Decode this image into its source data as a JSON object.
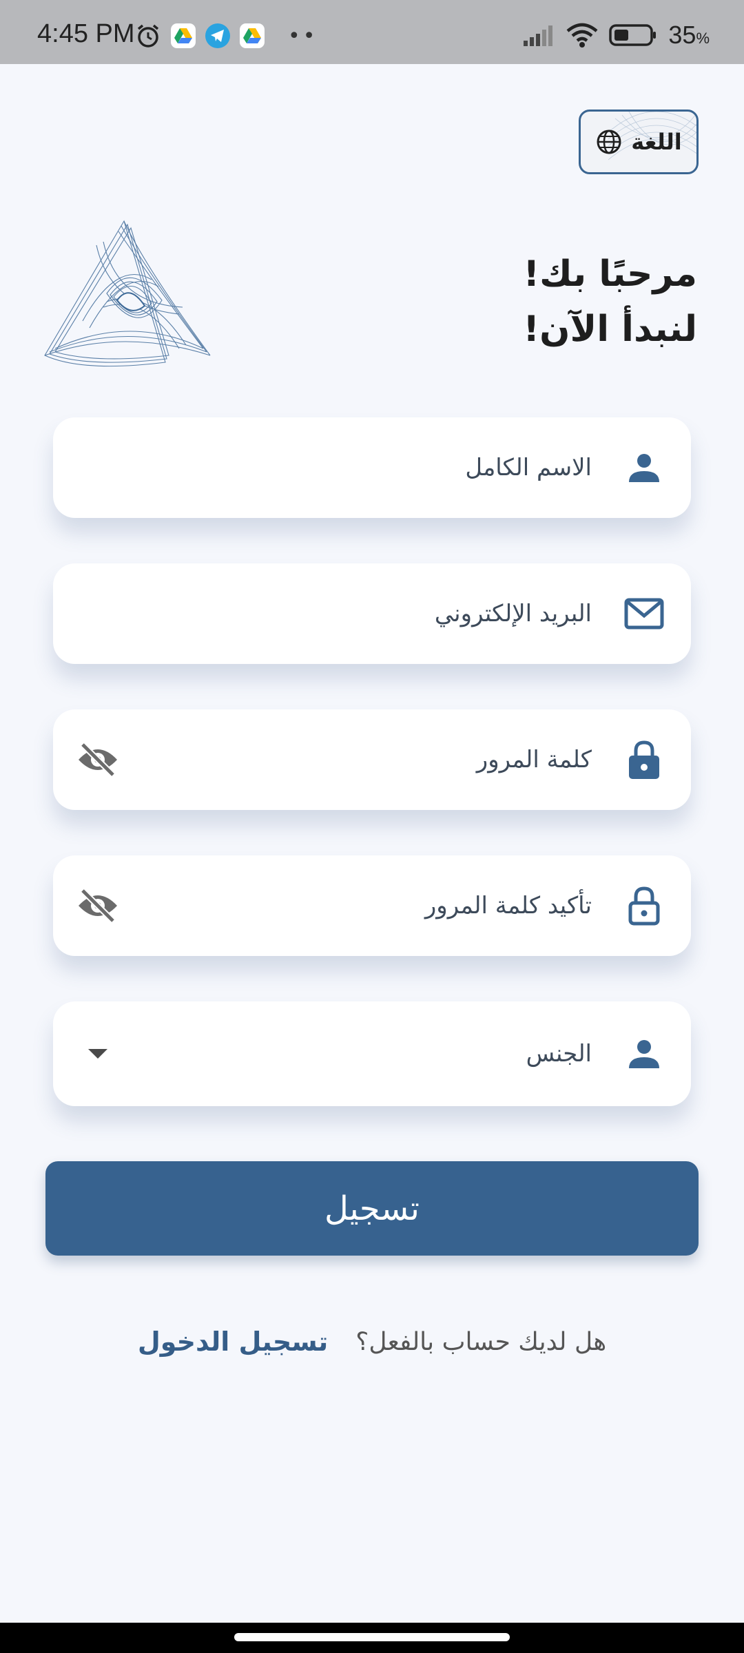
{
  "status_bar": {
    "time": "4:45 PM",
    "battery_percent": "35",
    "battery_unit": "%",
    "icons": [
      "alarm-icon",
      "google-drive-icon",
      "telegram-icon",
      "google-drive-icon",
      "signal-icon",
      "wifi-icon",
      "battery-icon"
    ]
  },
  "language_button": {
    "label": "اللغة",
    "icon": "globe-icon"
  },
  "welcome": {
    "line1": "مرحبًا بك!",
    "line2": "لنبدأ الآن!"
  },
  "form": {
    "full_name": {
      "placeholder": "الاسم الكامل",
      "icon": "person-icon"
    },
    "email": {
      "placeholder": "البريد الإلكتروني",
      "icon": "mail-icon"
    },
    "password": {
      "placeholder": "كلمة المرور",
      "icon": "lock-icon",
      "toggle_icon": "eye-off-icon"
    },
    "confirm_password": {
      "placeholder": "تأكيد كلمة المرور",
      "icon": "lock-outline-icon",
      "toggle_icon": "eye-off-icon"
    },
    "gender": {
      "placeholder": "الجنس",
      "icon": "person-icon",
      "dropdown_icon": "caret-down-icon"
    }
  },
  "register_button": {
    "label": "تسجيل"
  },
  "login_prompt": {
    "question": "هل لديك حساب بالفعل؟",
    "link": "تسجيل الدخول"
  },
  "colors": {
    "primary": "#37628f",
    "background": "#f5f7fc",
    "icon": "#3a6591",
    "status_bar": "#b7b8bb"
  }
}
